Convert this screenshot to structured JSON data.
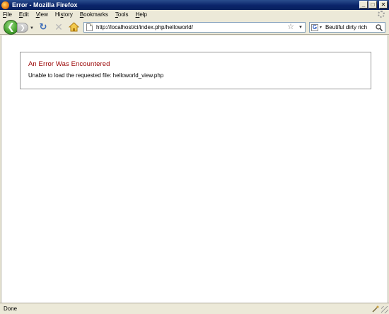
{
  "window": {
    "title": "Error - Mozilla Firefox",
    "minimize": "_",
    "maximize": "□",
    "close": "✕"
  },
  "menu": {
    "items": [
      {
        "key": "F",
        "rest": "ile"
      },
      {
        "key": "E",
        "rest": "dit"
      },
      {
        "key": "V",
        "rest": "iew"
      },
      {
        "pre": "Hi",
        "key": "s",
        "rest": "tory"
      },
      {
        "key": "B",
        "rest": "ookmarks"
      },
      {
        "key": "T",
        "rest": "ools"
      },
      {
        "key": "H",
        "rest": "elp"
      }
    ]
  },
  "toolbar": {
    "back_icon": "back-arrow-icon",
    "forward_icon": "forward-arrow-icon",
    "reload_icon": "reload-icon",
    "stop_icon": "stop-icon",
    "home_icon": "home-icon",
    "url": "http://localhost/ci/index.php/helloworld/",
    "search_engine": "G",
    "search_query": "Beutiful dirty rich"
  },
  "page": {
    "error_title": "An Error Was Encountered",
    "error_message": "Unable to load the requested file: helloworld_view.php"
  },
  "status": {
    "text": "Done"
  },
  "colors": {
    "titlebar": "#0a246a",
    "error_title": "#990000",
    "chrome": "#ece9d8"
  }
}
